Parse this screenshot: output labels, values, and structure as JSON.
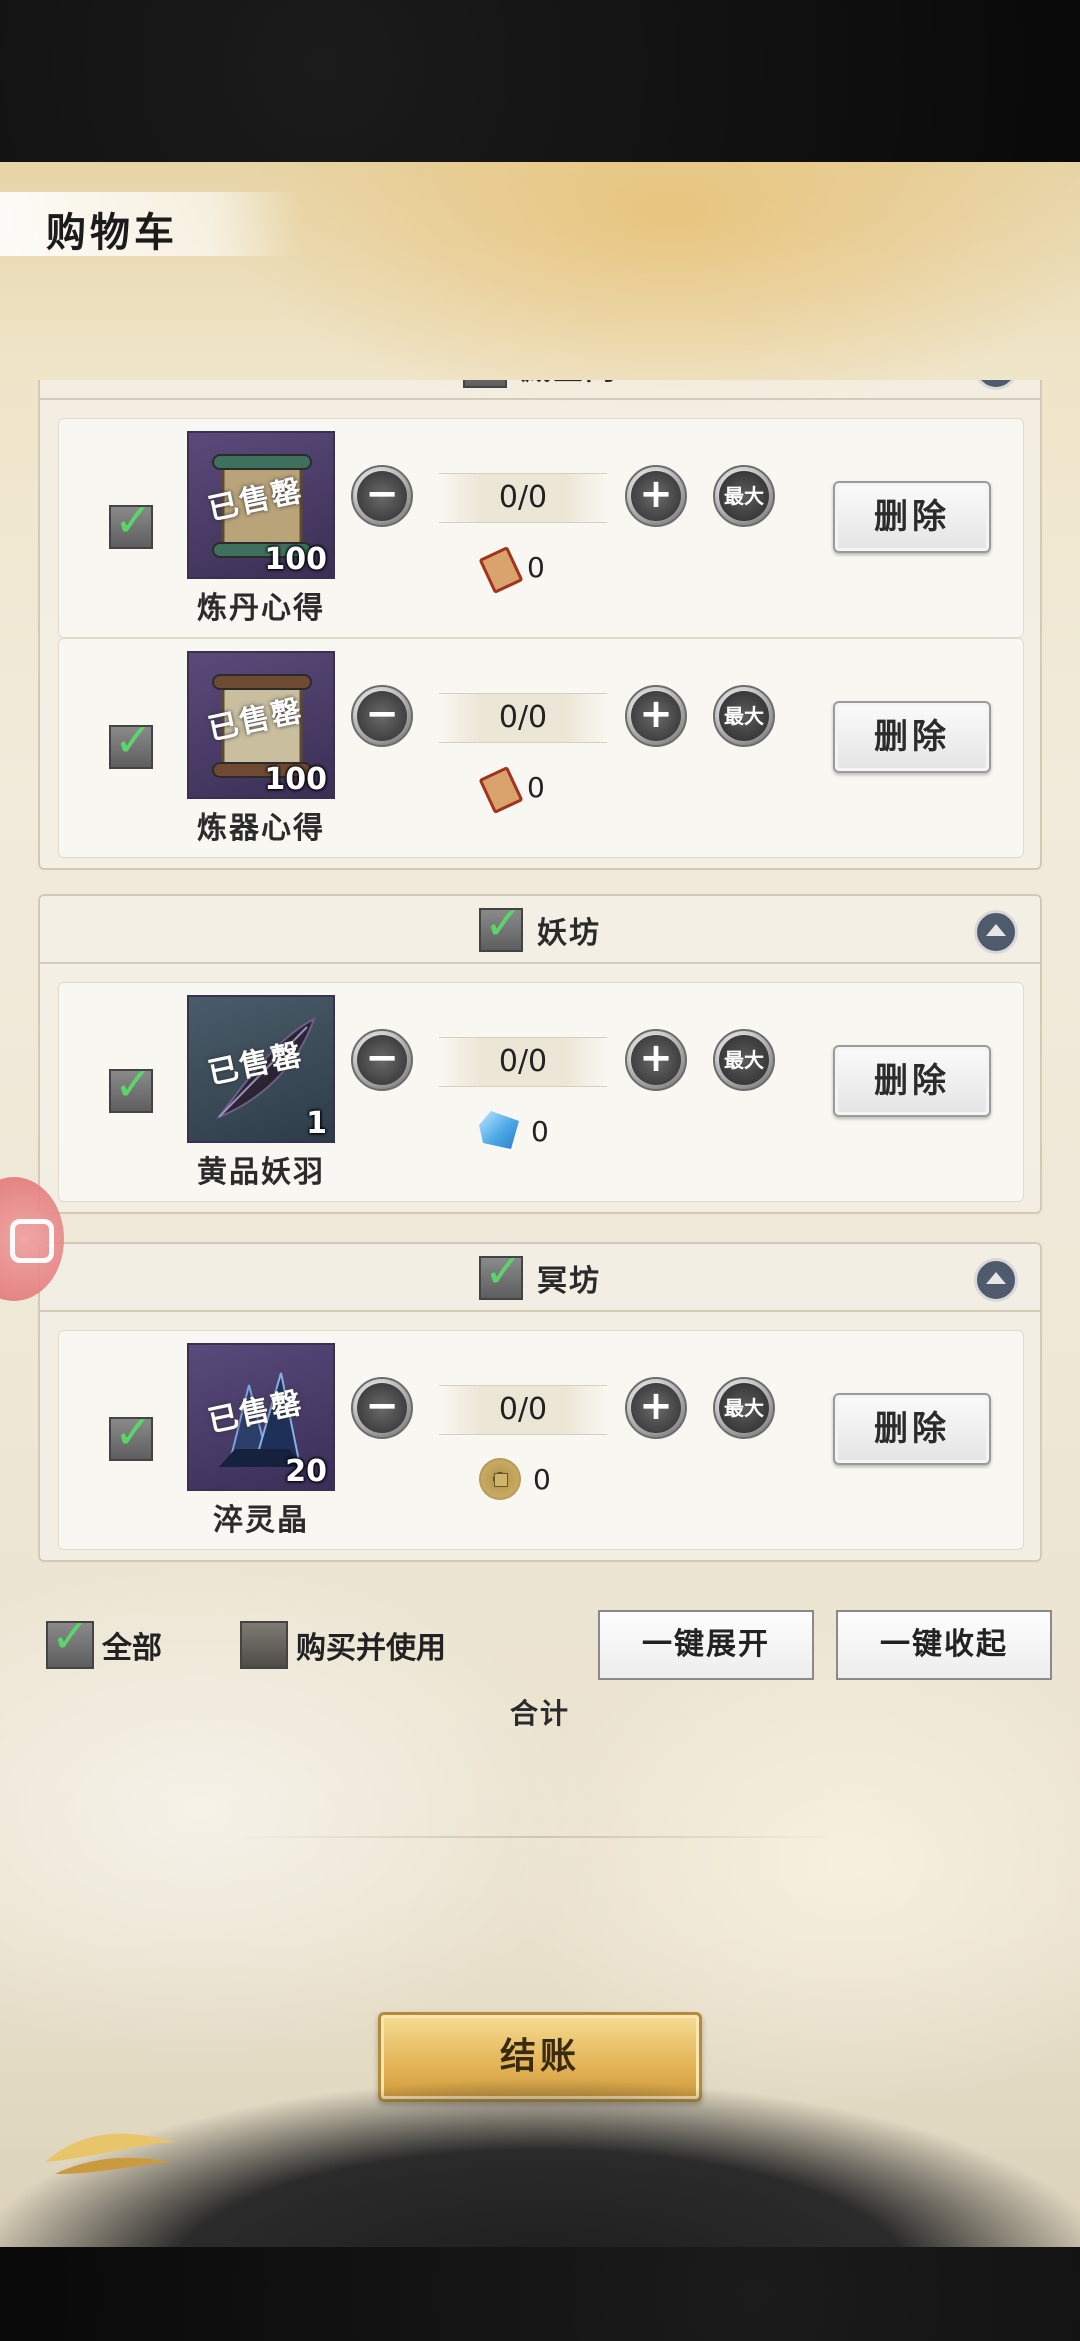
{
  "header": {
    "title": "购物车"
  },
  "shops": [
    {
      "name": "藏宝阁",
      "checked": true,
      "items": [
        {
          "name": "炼丹心得",
          "count": "100",
          "sold_mark": "已售罄",
          "quantity": "0/0",
          "price": "0",
          "currency_icon": "scroll-icon",
          "checked": true,
          "delete_label": "删除"
        },
        {
          "name": "炼器心得",
          "count": "100",
          "sold_mark": "已售罄",
          "quantity": "0/0",
          "price": "0",
          "currency_icon": "scroll-icon",
          "checked": true,
          "delete_label": "删除"
        }
      ]
    },
    {
      "name": "妖坊",
      "checked": true,
      "items": [
        {
          "name": "黄品妖羽",
          "count": "1",
          "sold_mark": "已售罄",
          "quantity": "0/0",
          "price": "0",
          "currency_icon": "crystal-icon",
          "checked": true,
          "delete_label": "删除"
        }
      ]
    },
    {
      "name": "冥坊",
      "checked": true,
      "items": [
        {
          "name": "淬灵晶",
          "count": "20",
          "sold_mark": "已售罄",
          "quantity": "0/0",
          "price": "0",
          "currency_icon": "coin-icon",
          "checked": true,
          "delete_label": "删除"
        }
      ]
    }
  ],
  "controls": {
    "max_label": "最大",
    "select_all": {
      "label": "全部",
      "checked": true
    },
    "buy_and_use": {
      "label": "购买并使用",
      "checked": false
    },
    "expand_all": "一键展开",
    "collapse_all": "一键收起",
    "total_label": "合计",
    "checkout": "结账"
  },
  "colors": {
    "checkout_gold": "#e3b457",
    "check_green": "#5bd46b",
    "collapse_blue": "#4f5a6c"
  }
}
